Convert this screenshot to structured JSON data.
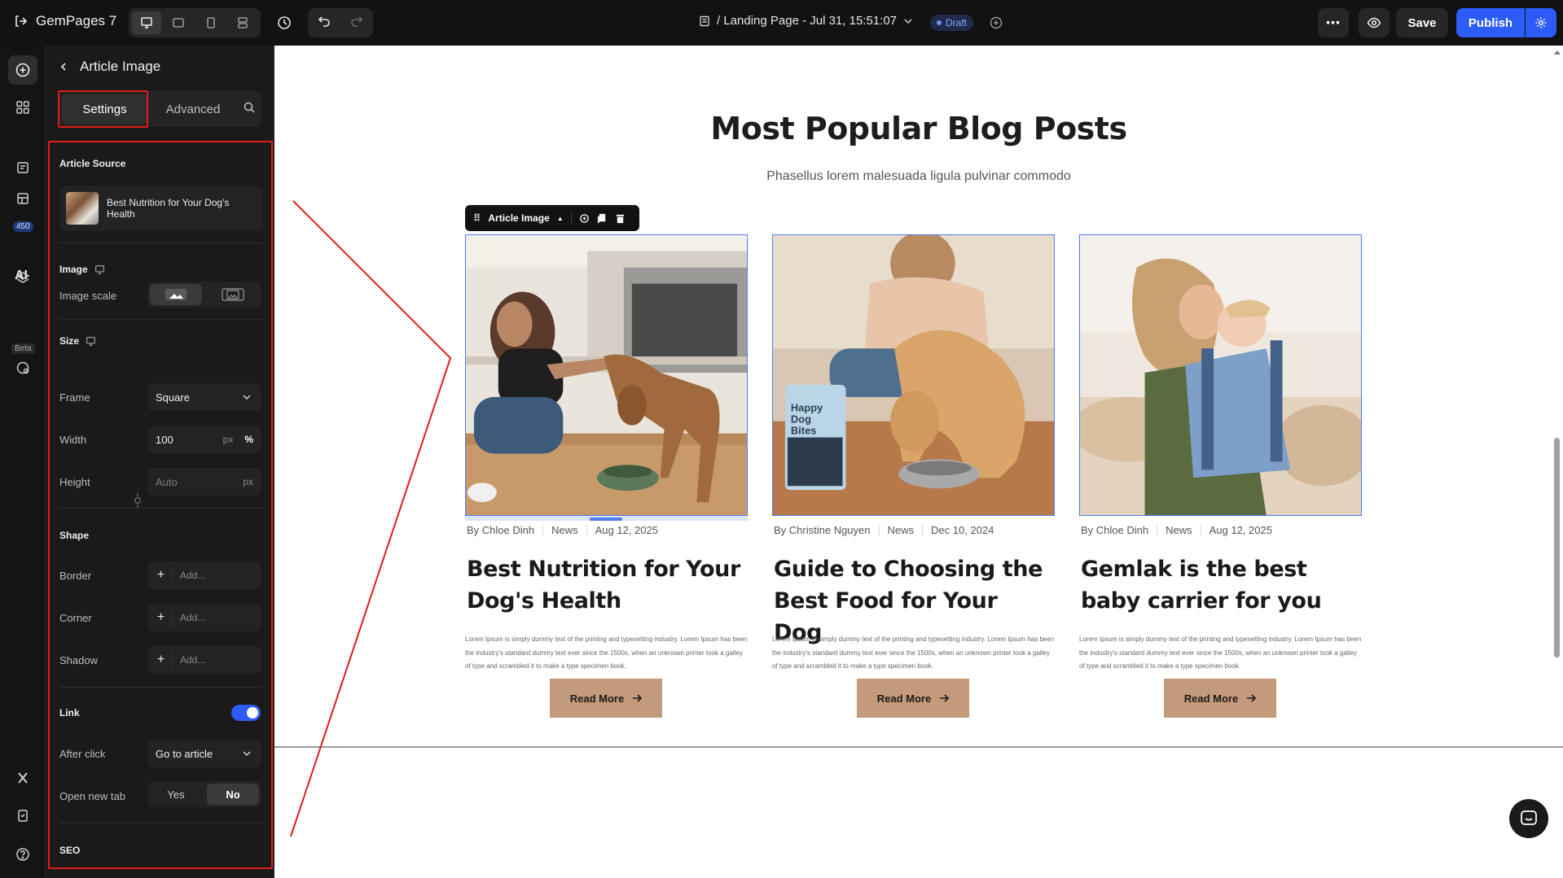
{
  "app": {
    "brand": "GemPages 7",
    "page_title": "/ Landing Page - Jul 31, 15:51:07",
    "status": "Draft",
    "save_label": "Save",
    "publish_label": "Publish",
    "accent": "#2c5bf6",
    "highlight": "#e21b1b"
  },
  "rail": {
    "pages_badge": "450",
    "ai_label": "AI",
    "beta_label": "Beta"
  },
  "panel": {
    "title": "Article Image",
    "tabs": {
      "settings": "Settings",
      "advanced": "Advanced"
    },
    "article_source": {
      "heading": "Article Source",
      "article": "Best Nutrition for Your Dog's Health"
    },
    "image": {
      "heading": "Image",
      "scale_label": "Image scale"
    },
    "size": {
      "heading": "Size",
      "frame_label": "Frame",
      "frame_value": "Square",
      "width_label": "Width",
      "width_value": "100",
      "width_unit_px": "px",
      "width_unit_pct": "%",
      "height_label": "Height",
      "height_placeholder": "Auto",
      "height_unit": "px"
    },
    "shape": {
      "heading": "Shape",
      "border_label": "Border",
      "corner_label": "Corner",
      "shadow_label": "Shadow",
      "add_placeholder": "Add..."
    },
    "link": {
      "heading": "Link",
      "enabled": true,
      "after_click_label": "After click",
      "after_click_value": "Go to article",
      "new_tab_label": "Open new tab",
      "yes": "Yes",
      "no": "No",
      "selected": "No"
    },
    "seo": {
      "heading": "SEO"
    }
  },
  "canvas": {
    "heading": "Most Popular Blog Posts",
    "subheading": "Phasellus lorem malesuada ligula pulvinar commodo",
    "toolbar_label": "Article Image",
    "read_more": "Read More",
    "posts": [
      {
        "author": "By Chloe Dinh",
        "category": "News",
        "date": "Aug 12, 2025",
        "title": "Best Nutrition for Your Dog's Health",
        "excerpt": "Lorem Ipsum is simply dummy text of the printing and typesetting industry. Lorem Ipsum has been the industry's standard dummy text ever since the 1500s, when an unknown printer took a galley of type and scrambled it to make a type specimen book."
      },
      {
        "author": "By Christine Nguyen",
        "category": "News",
        "date": "Dec 10, 2024",
        "title": "Guide to Choosing the Best Food for Your Dog",
        "excerpt": "Lorem Ipsum is simply dummy text of the printing and typesetting industry. Lorem Ipsum has been the industry's standard dummy text ever since the 1500s, when an unknown printer took a galley of type and scrambled it to make a type specimen book.",
        "bag_text": "Happy Dog Bites"
      },
      {
        "author": "By Chloe Dinh",
        "category": "News",
        "date": "Aug 12, 2025",
        "title": "Gemlak is the best baby carrier for you",
        "excerpt": "Lorem Ipsum is simply dummy text of the printing and typesetting industry. Lorem Ipsum has been the industry's standard dummy text ever since the 1500s, when an unknown printer took a galley of type and scrambled it to make a type specimen book."
      }
    ]
  }
}
